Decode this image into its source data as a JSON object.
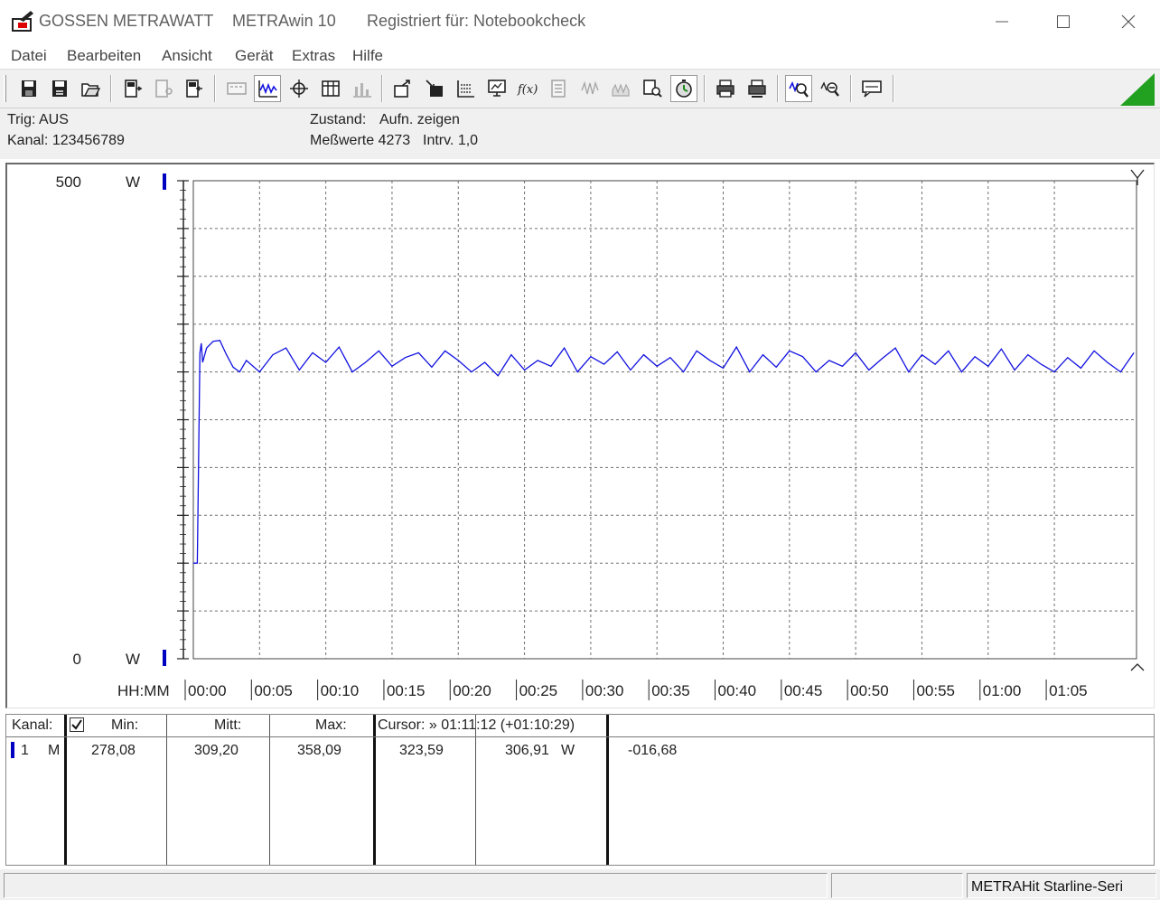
{
  "window": {
    "title_company": "GOSSEN METRAWATT",
    "title_app": "METRAwin 10",
    "title_registered": "Registriert für: Notebookcheck"
  },
  "menu": [
    "Datei",
    "Bearbeiten",
    "Ansicht",
    "Gerät",
    "Extras",
    "Hilfe"
  ],
  "toolbar": {
    "buttons": [
      {
        "name": "save-icon",
        "state": "normal"
      },
      {
        "name": "save-as-icon",
        "state": "normal"
      },
      {
        "name": "open-folder-icon",
        "state": "normal"
      },
      {
        "name": "device-read-icon",
        "state": "normal"
      },
      {
        "name": "device-config-icon",
        "state": "disabled"
      },
      {
        "name": "device-send-icon",
        "state": "normal"
      },
      {
        "name": "digital-display-icon",
        "state": "disabled"
      },
      {
        "name": "curve-view-icon",
        "state": "pressed"
      },
      {
        "name": "xy-view-icon",
        "state": "normal"
      },
      {
        "name": "table-view-icon",
        "state": "normal"
      },
      {
        "name": "bar-view-icon",
        "state": "disabled"
      },
      {
        "name": "export-icon",
        "state": "normal"
      },
      {
        "name": "import-icon",
        "state": "normal"
      },
      {
        "name": "scale-icon",
        "state": "normal"
      },
      {
        "name": "monitor-icon",
        "state": "normal"
      },
      {
        "name": "formula-icon",
        "state": "normal"
      },
      {
        "name": "calc-icon",
        "state": "disabled"
      },
      {
        "name": "wave-icon",
        "state": "disabled"
      },
      {
        "name": "wave-fill-icon",
        "state": "disabled"
      },
      {
        "name": "device-search-icon",
        "state": "normal"
      },
      {
        "name": "timer-icon",
        "state": "pressed"
      },
      {
        "name": "print-icon",
        "state": "normal"
      },
      {
        "name": "print-setup-icon",
        "state": "normal"
      },
      {
        "name": "zoom-curve-icon",
        "state": "pressed"
      },
      {
        "name": "zoom-out-icon",
        "state": "normal"
      },
      {
        "name": "comment-icon",
        "state": "normal"
      }
    ]
  },
  "info": {
    "trig": "Trig: AUS",
    "kanal": "Kanal: 123456789",
    "zustand_label": "Zustand:",
    "zustand_value": "Aufn. zeigen",
    "messwerte": "Meßwerte 4273",
    "intrv": "Intrv. 1,0"
  },
  "colors": {
    "series": "#1010e0",
    "channel_marker": "#0000c0",
    "grid": "#707070"
  },
  "chart_data": {
    "type": "line",
    "title": "",
    "xlabel": "HH:MM",
    "ylabel": "W",
    "ylim": [
      0,
      500
    ],
    "xlim_min": [
      0,
      71.2
    ],
    "grid": true,
    "y_axis": {
      "top_label": "500",
      "bottom_label": "0",
      "unit_top": "W",
      "unit_bottom": "W"
    },
    "x_ticks": [
      {
        "min": 0,
        "label": "00:00"
      },
      {
        "min": 5,
        "label": "00:05"
      },
      {
        "min": 10,
        "label": "00:10"
      },
      {
        "min": 15,
        "label": "00:15"
      },
      {
        "min": 20,
        "label": "00:20"
      },
      {
        "min": 25,
        "label": "00:25"
      },
      {
        "min": 30,
        "label": "00:30"
      },
      {
        "min": 35,
        "label": "00:35"
      },
      {
        "min": 40,
        "label": "00:40"
      },
      {
        "min": 45,
        "label": "00:45"
      },
      {
        "min": 50,
        "label": "00:50"
      },
      {
        "min": 55,
        "label": "00:55"
      },
      {
        "min": 60,
        "label": "01:00"
      },
      {
        "min": 65,
        "label": "01:05"
      }
    ],
    "series": [
      {
        "x": [
          0,
          0.3,
          0.5,
          0.6,
          0.7,
          1.0,
          1.5,
          2.0,
          2.5,
          3.0,
          3.5,
          4.0,
          5.0,
          6.0,
          7.0,
          8.0,
          9.0,
          10.0,
          11.0,
          12.0,
          13.0,
          14.0,
          15.0,
          16.0,
          17.0,
          18.0,
          19.0,
          20.0,
          21.0,
          22.0,
          23.0,
          24.0,
          25.0,
          26.0,
          27.0,
          28.0,
          29.0,
          30.0,
          31.0,
          32.0,
          33.0,
          34.0,
          35.0,
          36.0,
          37.0,
          38.0,
          39.0,
          40.0,
          41.0,
          42.0,
          43.0,
          44.0,
          45.0,
          46.0,
          47.0,
          48.0,
          49.0,
          50.0,
          51.0,
          52.0,
          53.0,
          54.0,
          55.0,
          56.0,
          57.0,
          58.0,
          59.0,
          60.0,
          61.0,
          62.0,
          63.0,
          64.0,
          65.0,
          66.0,
          67.0,
          68.0,
          69.0,
          70.0,
          71.0
        ],
        "y": [
          100,
          100,
          320,
          330,
          310,
          325,
          332,
          333,
          318,
          305,
          300,
          312,
          300,
          318,
          325,
          302,
          320,
          310,
          326,
          300,
          310,
          322,
          306,
          315,
          320,
          305,
          322,
          312,
          300,
          310,
          296,
          318,
          302,
          312,
          306,
          325,
          300,
          316,
          308,
          321,
          302,
          318,
          306,
          315,
          300,
          322,
          312,
          304,
          326,
          300,
          318,
          305,
          322,
          316,
          300,
          312,
          306,
          320,
          302,
          314,
          325,
          300,
          318,
          308,
          322,
          300,
          316,
          306,
          324,
          302,
          318,
          308,
          300,
          315,
          304,
          322,
          310,
          300,
          320
        ]
      }
    ]
  },
  "table": {
    "headers": {
      "kanal": "Kanal:",
      "min": "Min:",
      "mitt": "Mitt:",
      "max": "Max:",
      "cursor": "Cursor: » 01:11:12 (+01:10:29)"
    },
    "rows": [
      {
        "channel": "1",
        "mode": "M",
        "min": "278,08",
        "mitt": "309,20",
        "max": "358,09",
        "cursor1": "323,59",
        "cursor2": "306,91",
        "unit": "W",
        "delta": "-016,68"
      }
    ]
  },
  "statusbar": {
    "device": "METRAHit Starline-Seri"
  }
}
